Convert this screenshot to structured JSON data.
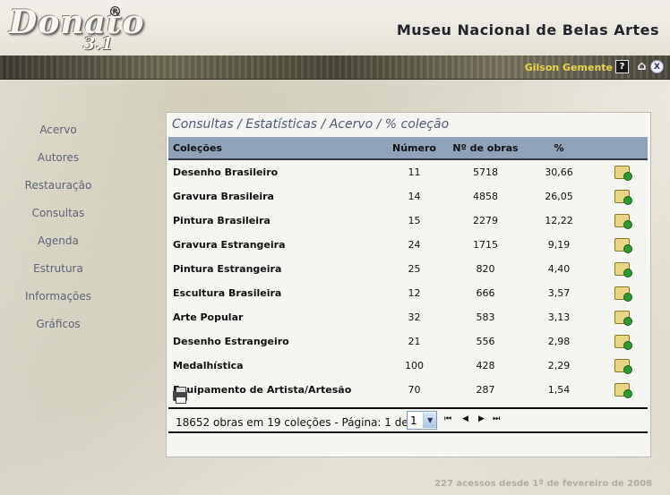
{
  "app": {
    "logo_text": "Donato",
    "logo_version": "3.1",
    "logo_reg": "®",
    "museum_title": "Museu Nacional de Belas Artes"
  },
  "user": {
    "name": "Gilson Gemente",
    "help_icon": "?",
    "home_icon": "⌂",
    "close_icon": "X"
  },
  "sidebar": {
    "items": [
      {
        "label": "Acervo"
      },
      {
        "label": "Autores"
      },
      {
        "label": "Restauração"
      },
      {
        "label": "Consultas"
      },
      {
        "label": "Agenda"
      },
      {
        "label": "Estrutura"
      },
      {
        "label": "Informações"
      },
      {
        "label": "Gráficos"
      }
    ]
  },
  "panel": {
    "breadcrumb": "Consultas / Estatísticas / Acervo / % coleção",
    "columns": {
      "name": "Coleções",
      "numero": "Número",
      "obras": "Nº de obras",
      "pct": "%"
    },
    "rows": [
      {
        "name": "Desenho Brasileiro",
        "numero": "11",
        "obras": "5718",
        "pct": "30,66"
      },
      {
        "name": "Gravura Brasileira",
        "numero": "14",
        "obras": "4858",
        "pct": "26,05"
      },
      {
        "name": "Pintura Brasileira",
        "numero": "15",
        "obras": "2279",
        "pct": "12,22"
      },
      {
        "name": "Gravura Estrangeira",
        "numero": "24",
        "obras": "1715",
        "pct": "9,19"
      },
      {
        "name": "Pintura Estrangeira",
        "numero": "25",
        "obras": "820",
        "pct": "4,40"
      },
      {
        "name": "Escultura Brasileira",
        "numero": "12",
        "obras": "666",
        "pct": "3,57"
      },
      {
        "name": "Arte Popular",
        "numero": "32",
        "obras": "583",
        "pct": "3,13"
      },
      {
        "name": "Desenho Estrangeiro",
        "numero": "21",
        "obras": "556",
        "pct": "2,98"
      },
      {
        "name": "Medalhística",
        "numero": "100",
        "obras": "428",
        "pct": "2,29"
      },
      {
        "name": "Equipamento de Artista/Artesão",
        "numero": "70",
        "obras": "287",
        "pct": "1,54"
      }
    ],
    "summary": "18652 obras em 19 coleções - Página: 1 de 2",
    "page_select": "1",
    "nav": {
      "first": "⏮",
      "prev": "◀",
      "next": "▶",
      "last": "⏭"
    }
  },
  "footer": {
    "access_text": "227 acessos desde 1º de fevereiro de 2008"
  }
}
